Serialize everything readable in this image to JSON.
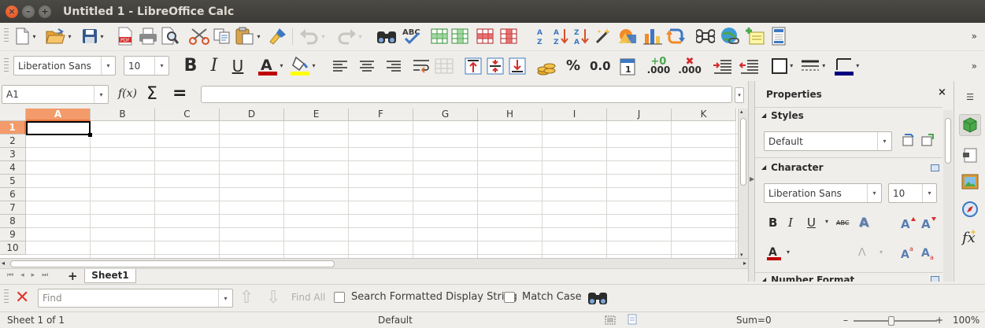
{
  "window": {
    "title": "Untitled 1 - LibreOffice Calc",
    "close_glyph": "×",
    "min_glyph": "–",
    "max_glyph": "+"
  },
  "toolbar_standard": {
    "items": [
      "new-icon",
      "open-icon",
      "save-icon",
      "export-pdf-icon",
      "print-icon",
      "print-preview-icon",
      "cut-icon",
      "copy-icon",
      "paste-icon",
      "clone-formatting-icon",
      "undo-icon",
      "redo-icon",
      "find-replace-icon",
      "spelling-icon",
      "row-icon",
      "column-icon",
      "insert-row-icon",
      "insert-column-icon",
      "sort-icon",
      "sort-ascending-icon",
      "sort-descending-icon",
      "autofilter-icon",
      "image-icon",
      "chart-icon",
      "pivot-table-icon",
      "special-character-icon",
      "hyperlink-icon",
      "comment-icon",
      "headers-footers-icon"
    ],
    "overflow": "»"
  },
  "toolbar_formatting": {
    "font_name": "Liberation Sans",
    "font_size": "10",
    "bold": "B",
    "italic": "I",
    "underline": "U",
    "currency": "$",
    "percent": "%",
    "decimal": "0.0",
    "add_decimal": ".000",
    "remove_decimal": ".000",
    "font_color": "#c00000",
    "highlight_color": "#ffff00",
    "border_color": "#000080",
    "overflow": "»"
  },
  "formula_bar": {
    "name_box": "A1",
    "function_wizard": "f(x)",
    "sum": "Σ",
    "equals": "=",
    "content": ""
  },
  "grid": {
    "columns": [
      "A",
      "B",
      "C",
      "D",
      "E",
      "F",
      "G",
      "H",
      "I",
      "J",
      "K"
    ],
    "rows": [
      "1",
      "2",
      "3",
      "4",
      "5",
      "6",
      "7",
      "8",
      "9",
      "10"
    ],
    "selected_cell": "A1",
    "selection_color": "#f39b6a"
  },
  "sheet_tabs": {
    "add": "+",
    "tabs": [
      "Sheet1"
    ]
  },
  "find_bar": {
    "placeholder": "Find",
    "find_all": "Find All",
    "search_formatted": "Search Formatted Display String",
    "match_case": "Match Case"
  },
  "status_bar": {
    "sheet": "Sheet 1 of 1",
    "page_style": "Default",
    "sum": "Sum=0",
    "zoom_minus": "–",
    "zoom_plus": "+",
    "zoom": "100%"
  },
  "sidebar": {
    "title": "Properties",
    "close": "×",
    "styles_section": "Styles",
    "style_value": "Default",
    "character_section": "Character",
    "font_name": "Liberation Sans",
    "font_size": "10",
    "bold": "B",
    "italic": "I",
    "underline": "U",
    "strike": "ABC",
    "shadow": "A",
    "next_section": "Number Format"
  },
  "deck": {
    "items": [
      "menu-icon",
      "properties-icon",
      "styles-icon",
      "gallery-icon",
      "navigator-icon",
      "functions-icon"
    ]
  }
}
